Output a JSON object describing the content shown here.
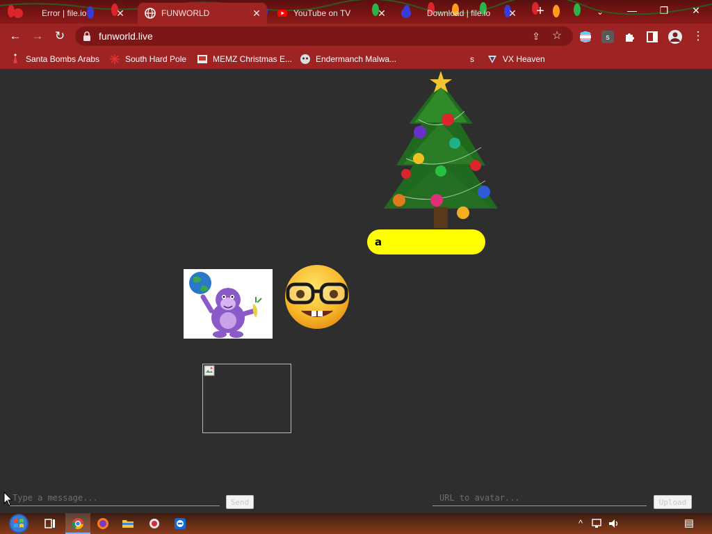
{
  "browser": {
    "tabs": [
      {
        "label": "Error | file.io",
        "favicon": "file-io-icon",
        "active": false
      },
      {
        "label": "FUNWORLD",
        "favicon": "globe-icon",
        "active": true
      },
      {
        "label": "YouTube on TV",
        "favicon": "youtube-icon",
        "active": false
      },
      {
        "label": "Download | file.io",
        "favicon": "file-io-icon",
        "active": false
      }
    ],
    "close_glyph": "✕",
    "new_tab_glyph": "+",
    "tab_search_glyph": "⌄",
    "window_controls": {
      "minimize": "—",
      "restore": "❐",
      "close": "✕"
    },
    "nav": {
      "back": "←",
      "forward": "→",
      "reload": "↻"
    },
    "url": "funworld.live",
    "share_glyph": "⇪",
    "star_glyph": "☆",
    "menu_glyph": "⋮",
    "bookmarks": [
      {
        "label": "Santa Bombs Arabs",
        "icon": "santa-icon"
      },
      {
        "label": "South Hard Pole",
        "icon": "snowflake-icon"
      },
      {
        "label": "MEMZ Christmas E...",
        "icon": "memz-icon"
      },
      {
        "label": "Endermanch Malwa...",
        "icon": "endermanch-icon"
      },
      {
        "label": "s",
        "icon": "hidden-icon"
      },
      {
        "label": "VX Heaven",
        "icon": "vx-heaven-icon"
      }
    ],
    "theme_colors": {
      "tabstrip": "#7b1414",
      "toolbar": "#9e2424"
    }
  },
  "page": {
    "chat_bubble_text": "a",
    "bubble_color": "#ffff00",
    "message_placeholder": "Type a message...",
    "send_label": "Send",
    "avatar_placeholder": "URL to avatar...",
    "avatar_button_label": "Upload",
    "images": [
      "christmas-tree",
      "bonzi-buddy",
      "nerd-face-emoji",
      "broken-image"
    ]
  },
  "taskbar": {
    "apps": [
      "windows-start",
      "task-view",
      "chrome",
      "firefox",
      "file-explorer",
      "app-red",
      "teamviewer"
    ],
    "tray": {
      "chevron": "^",
      "notifications_glyph": "▤"
    }
  }
}
